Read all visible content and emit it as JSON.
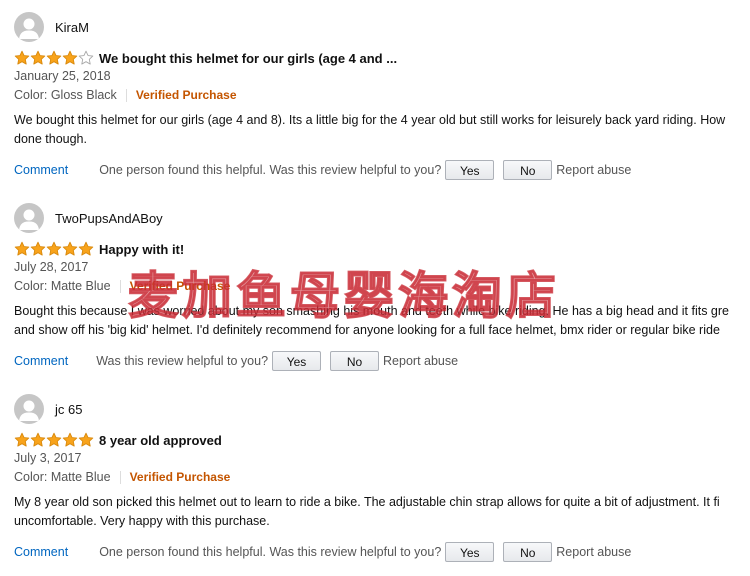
{
  "colors": {
    "star": "#f8a31b",
    "link": "#0066c0",
    "verified": "#c45500",
    "watermark": "#cc3344"
  },
  "icons": {
    "avatar": "user-silhouette-icon",
    "star_full": "star-full-icon",
    "star_empty": "star-empty-icon"
  },
  "reviews": [
    {
      "author": "KiraM",
      "rating": 4,
      "rating_max": 5,
      "title": "We bought this helmet for our girls (age 4 and ...",
      "date": "January 25, 2018",
      "color_label": "Color: Gloss Black",
      "verified": "Verified Purchase",
      "body_lines": [
        "We bought this helmet for our girls (age 4 and 8). Its a little big for the 4 year old but still works for leisurely back yard riding. How",
        "done though."
      ],
      "comment": "Comment",
      "helpful": "One person found this helpful. Was this review helpful to you?",
      "yes": "Yes",
      "no": "No",
      "report": "Report abuse"
    },
    {
      "author": "TwoPupsAndABoy",
      "rating": 5,
      "rating_max": 5,
      "title": "Happy with it!",
      "date": "July 28, 2017",
      "color_label": "Color: Matte Blue",
      "verified": "Verified Purchase",
      "body_lines": [
        "Bought this because I was worried about my son smashing his mouth and teeth while bike riding. He has a big head and it fits gre",
        "and show off his 'big kid' helmet. I'd definitely recommend for anyone looking for a full face helmet, bmx rider or regular bike ride"
      ],
      "comment": "Comment",
      "helpful": "Was this review helpful to you?",
      "yes": "Yes",
      "no": "No",
      "report": "Report abuse"
    },
    {
      "author": "jc 65",
      "rating": 5,
      "rating_max": 5,
      "title": "8 year old approved",
      "date": "July 3, 2017",
      "color_label": "Color: Matte Blue",
      "verified": "Verified Purchase",
      "body_lines": [
        "My 8 year old son picked this helmet out to learn to ride a bike. The adjustable chin strap allows for quite a bit of adjustment. It fi",
        "uncomfortable. Very happy with this purchase."
      ],
      "comment": "Comment",
      "helpful": "One person found this helpful. Was this review helpful to you?",
      "yes": "Yes",
      "no": "No",
      "report": "Report abuse"
    }
  ],
  "watermark": "麦加鱼母婴海淘店"
}
